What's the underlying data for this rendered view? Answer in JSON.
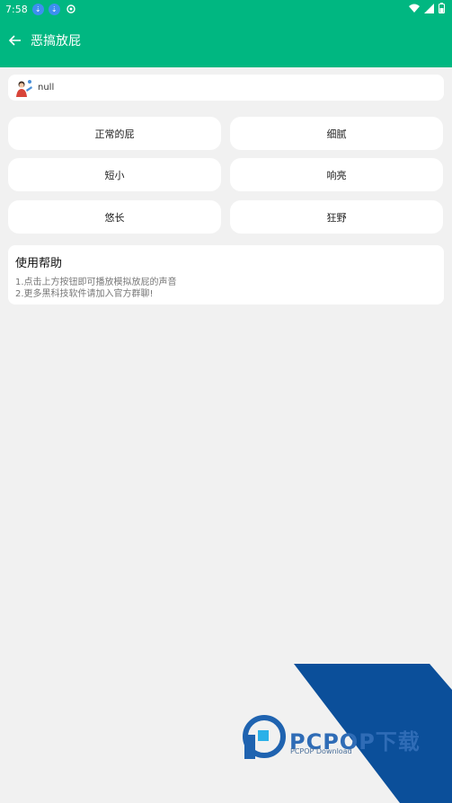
{
  "status_bar": {
    "time": "7:58"
  },
  "header": {
    "title": "恶搞放屁"
  },
  "user": {
    "name": "null"
  },
  "buttons": [
    {
      "label": "正常的屁"
    },
    {
      "label": "细腻"
    },
    {
      "label": "短小"
    },
    {
      "label": "响亮"
    },
    {
      "label": "悠长"
    },
    {
      "label": "狂野"
    }
  ],
  "help": {
    "title": "使用帮助",
    "lines": [
      "1.点击上方按钮即可播放模拟放屁的声音",
      "2.更多黑科技软件请加入官方群聊!"
    ]
  },
  "watermark": {
    "brand": "PCPOP下载",
    "sub": "PCPOP Download"
  },
  "colors": {
    "appbar": "#00b781",
    "page_bg": "#f1f1f1",
    "watermark_blue": "#0b4f9a"
  }
}
